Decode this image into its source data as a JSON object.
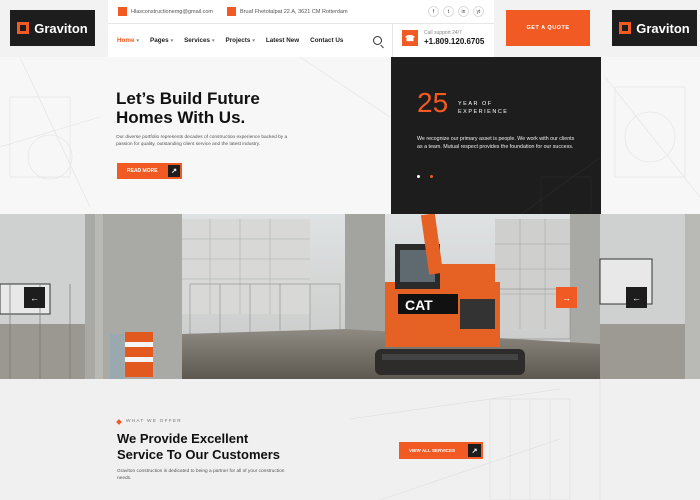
{
  "brand": {
    "name": "Graviton",
    "accent": "#f15a22",
    "dark": "#1d1d1d"
  },
  "topbar": {
    "email": "Hlasconstructionemg@gmail.com",
    "address": "Bruaf Fhetotalpat 22.A, 3621 CM Rotterdam",
    "socials": [
      "f",
      "t",
      "in",
      "yt"
    ]
  },
  "nav": {
    "items": [
      {
        "label": "Home",
        "caret": "▾"
      },
      {
        "label": "Pages",
        "caret": "▾"
      },
      {
        "label": "Services",
        "caret": "▾"
      },
      {
        "label": "Projects",
        "caret": "▾"
      },
      {
        "label": "Latest New",
        "caret": ""
      },
      {
        "label": "Contact Us",
        "caret": ""
      }
    ],
    "call_label": "Call support 24/7",
    "call_number": "+1.809.120.6705"
  },
  "header": {
    "quote_button": "GET A QUOTE"
  },
  "hero": {
    "title_line1": "Let’s Build Future",
    "title_line2": "Homes With Us.",
    "description": "Our diverse portfolio represents decades of construction experience backed by a passion for quality, outstanding client service and the latest industry.",
    "read_more": "READ MORE",
    "arrow": "↗"
  },
  "panel": {
    "years": "25",
    "years_label_line1": "YEAR OF",
    "years_label_line2": "EXPERIENCE",
    "text": "We recognize our primary asset is people. We work with our clients as a team. Mutual respect provides the foundation for our success."
  },
  "slider": {
    "prev": "←",
    "next": "→",
    "machine_brand": "CAT"
  },
  "services": {
    "eyebrow": "WHAT WE OFFER",
    "title_line1": "We Provide Excellent",
    "title_line2": "Service To Our Customers",
    "description": "Graviton construction is dedicated to being a partner for all of your construction needs.",
    "view_all": "VIEW ALL SERVICES",
    "arrow": "↗"
  }
}
